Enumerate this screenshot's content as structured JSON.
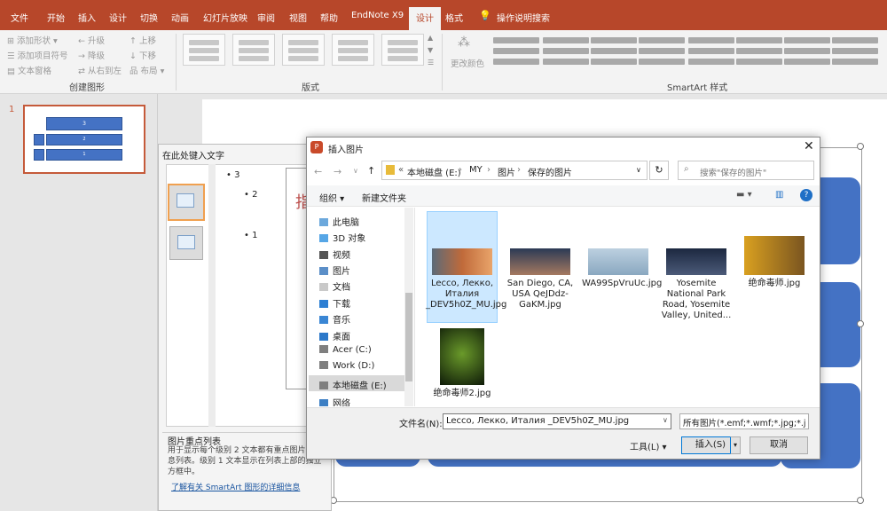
{
  "ribbon": {
    "tabs": [
      "文件",
      "开始",
      "插入",
      "设计",
      "切换",
      "动画",
      "幻灯片放映",
      "审阅",
      "视图",
      "帮助",
      "EndNote X9",
      "设计",
      "格式"
    ],
    "tell_me": "操作说明搜索",
    "create_graphic": {
      "add_shape": "添加形状",
      "add_bullet": "添加项目符号",
      "text_pane": "文本窗格",
      "promote": "升级",
      "demote": "降级",
      "right_to_left": "从右到左",
      "move_up": "上移",
      "move_down": "下移",
      "layout": "布局",
      "label": "创建图形"
    },
    "layouts_label": "版式",
    "change_colors": "更改颜色",
    "styles_label": "SmartArt 样式"
  },
  "thumbs": {
    "slide_number": "1",
    "labels": [
      "3",
      "2",
      "1"
    ]
  },
  "text_pane": {
    "title": "在此处键入文字",
    "bullets": [
      "3",
      "2",
      "1"
    ],
    "placeholder_char": "指",
    "desc_title": "图片重点列表",
    "desc_body": "用于显示每个级别 2 文本都有重点图片的信息列表。级别 1 文本显示在列表上部的独立方框中。",
    "learn_more": "了解有关 SmartArt 图形的详细信息"
  },
  "dialog": {
    "title": "插入图片",
    "breadcrumb": [
      "本地磁盘 (E:)",
      "MY",
      "图片",
      "保存的图片"
    ],
    "breadcrumb_prefix": "«",
    "search_placeholder": "搜索\"保存的图片\"",
    "organize": "组织",
    "new_folder": "新建文件夹",
    "nav_items": [
      "此电脑",
      "3D 对象",
      "视频",
      "图片",
      "文档",
      "下载",
      "音乐",
      "桌面",
      "Acer (C:)",
      "Work (D:)",
      "本地磁盘 (E:)",
      "网络"
    ],
    "files": [
      {
        "name": "Lecco, Лекко, Италия _DEV5h0Z_MU.jpg",
        "selected": true
      },
      {
        "name": "San Diego, CA, USA QeJDdz-GaKM.jpg",
        "selected": false
      },
      {
        "name": "WA99SpVruUc.jpg",
        "selected": false
      },
      {
        "name": "Yosemite National Park Road, Yosemite Valley, United...",
        "selected": false
      },
      {
        "name": "绝命毒师.jpg",
        "selected": false
      },
      {
        "name": "绝命毒师2.jpg",
        "selected": false
      }
    ],
    "filename_label": "文件名(N):",
    "filename_value": "Lecco, Лекко, Италия _DEV5h0Z_MU.jpg",
    "filter": "所有图片(*.emf;*.wmf;*.jpg;*.j",
    "tools": "工具(L)",
    "insert": "插入(S)",
    "cancel": "取消"
  },
  "colors": {
    "accent": "#b7472a",
    "smartart_blue": "#4472c4",
    "selection": "#cce8ff"
  }
}
